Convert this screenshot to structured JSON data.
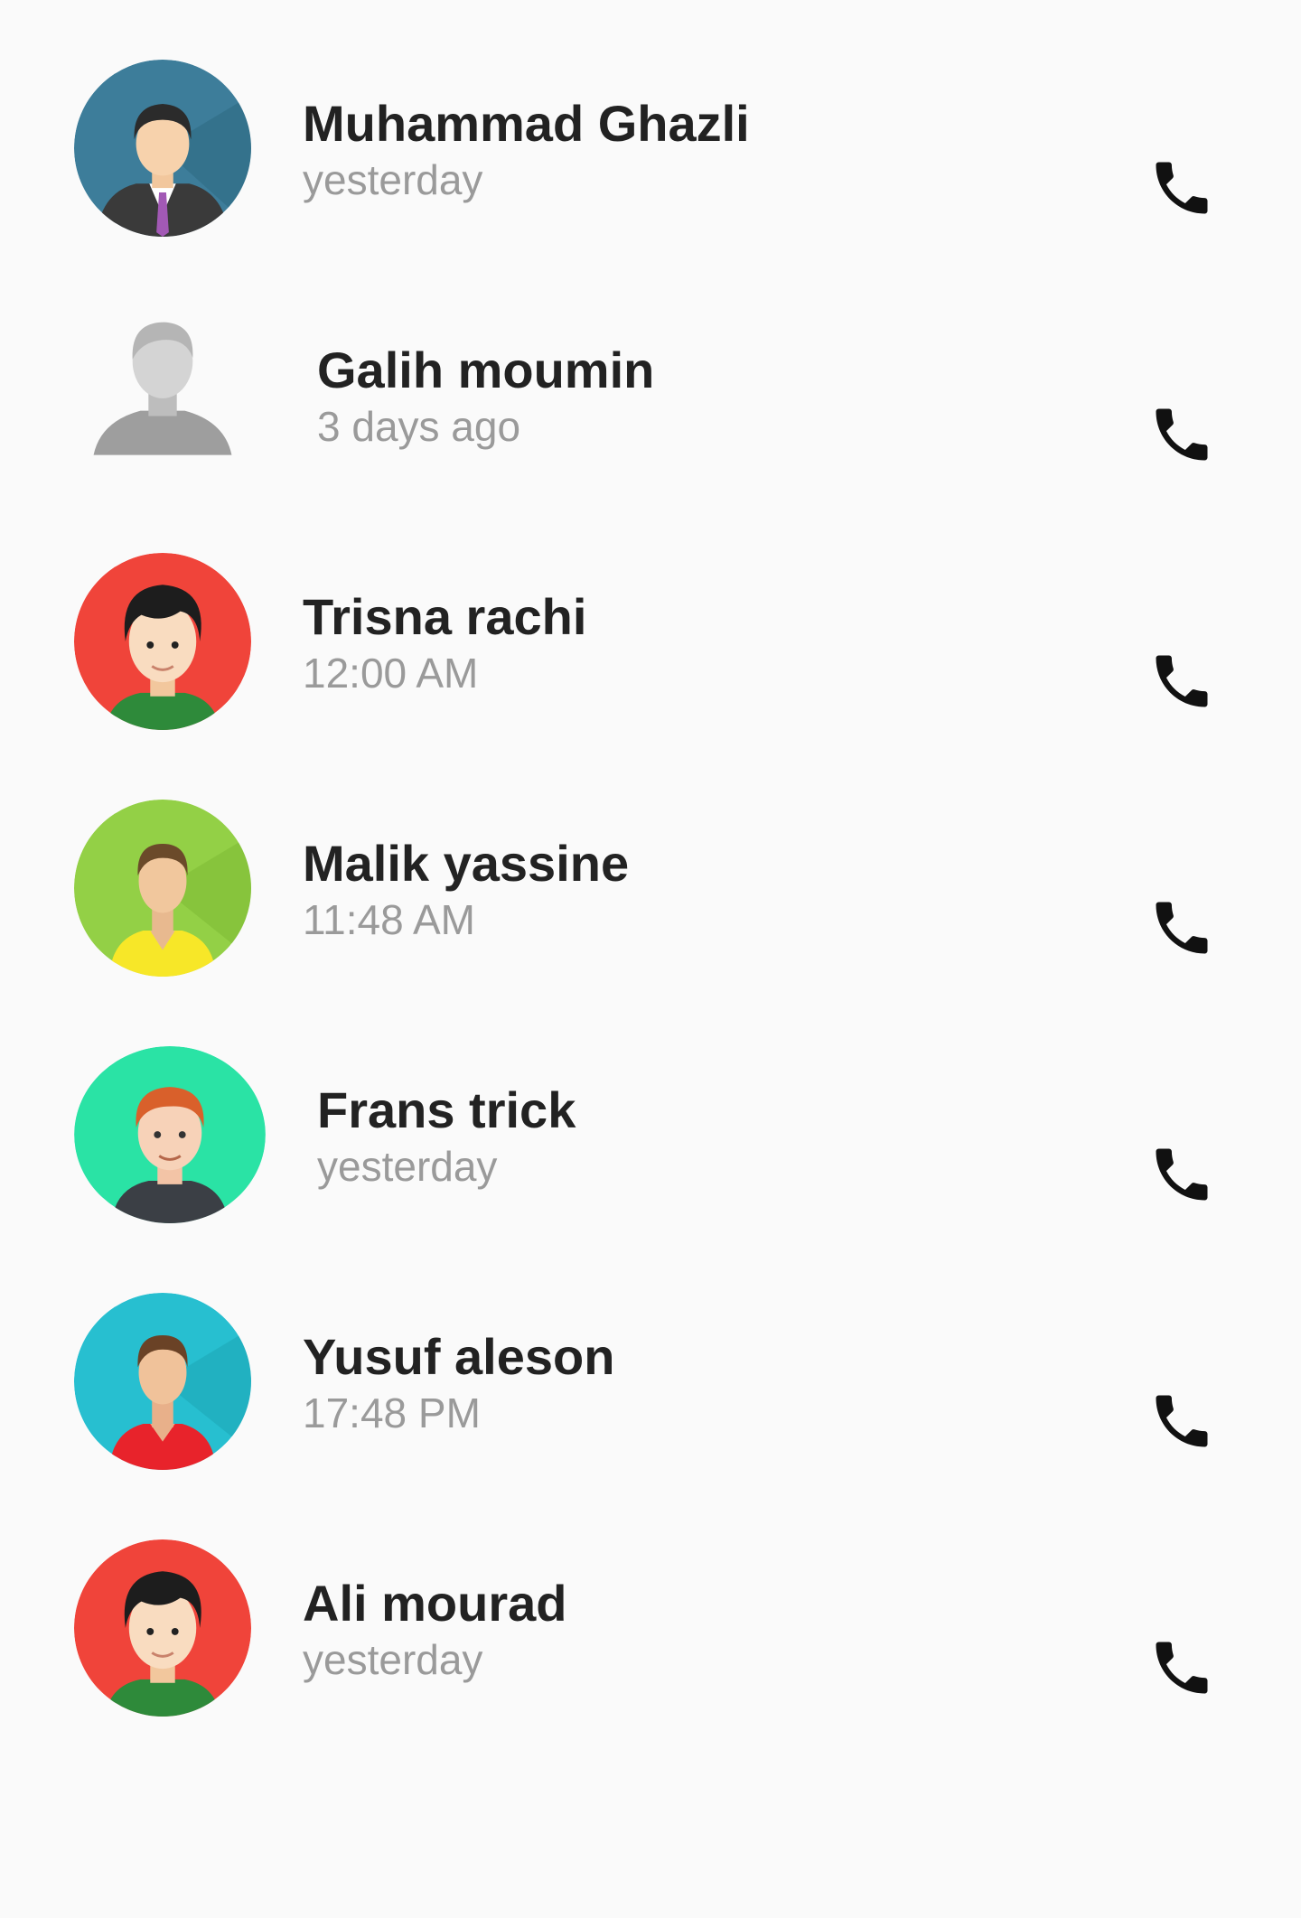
{
  "accent_colors": {
    "name_text": "#222222",
    "time_text": "#9a9a9a",
    "background": "#fafafa",
    "call_icon": "#111111"
  },
  "calls": [
    {
      "name": "Muhammad Ghazli",
      "time": "yesterday",
      "avatar_icon": "businessman-avatar-icon",
      "avatar_bg": "#3f7f9c"
    },
    {
      "name": "Galih moumin",
      "time": "3 days ago",
      "avatar_icon": "default-user-avatar-icon",
      "avatar_bg": "none"
    },
    {
      "name": "Trisna rachi",
      "time": "12:00 AM",
      "avatar_icon": "boy-avatar-icon",
      "avatar_bg": "#f0443a"
    },
    {
      "name": "Malik yassine",
      "time": "11:48 AM",
      "avatar_icon": "man-yellow-shirt-avatar-icon",
      "avatar_bg": "#93d046"
    },
    {
      "name": "Frans trick",
      "time": "yesterday",
      "avatar_icon": "redhead-man-avatar-icon",
      "avatar_bg": "#2ae3a5"
    },
    {
      "name": "Yusuf aleson",
      "time": "17:48 PM",
      "avatar_icon": "man-red-shirt-avatar-icon",
      "avatar_bg": "#27bfd0"
    },
    {
      "name": "Ali mourad",
      "time": "yesterday",
      "avatar_icon": "boy-avatar-icon",
      "avatar_bg": "#f0443a"
    }
  ],
  "call_icon": "phone-icon"
}
